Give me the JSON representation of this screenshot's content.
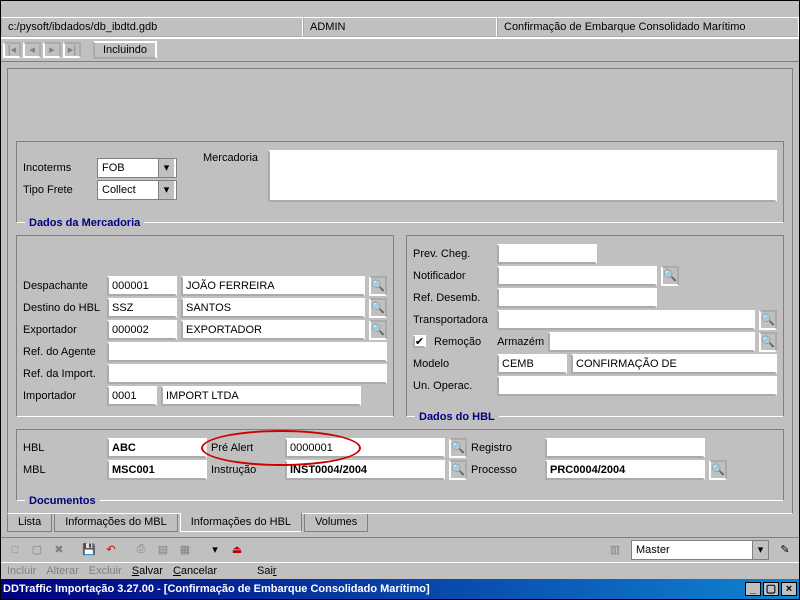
{
  "title": "DDTraffic Importação 3.27.00 - [Confirmação de Embarque Consolidado Marítimo]",
  "menu": {
    "incluir": "Incluir",
    "alterar": "Alterar",
    "excluir": "Excluir",
    "salvar": "Salvar",
    "cancelar": "Cancelar",
    "sair": "Sair"
  },
  "master": {
    "label": "Master"
  },
  "tabs": {
    "lista": "Lista",
    "imbl": "Informações do MBL",
    "ihbl": "Informações do HBL",
    "vol": "Volumes"
  },
  "doc": {
    "legend": "Documentos",
    "mbl_l": "MBL",
    "mbl": "MSC001",
    "instr_l": "Instrução",
    "instr": "INST0004/2004",
    "proc_l": "Processo",
    "proc": "PRC0004/2004",
    "hbl_l": "HBL",
    "hbl": "ABC",
    "pre_l": "Pré Alert",
    "pre": "0000001",
    "reg_l": "Registro",
    "reg": ""
  },
  "hbldata": {
    "legend": "Dados do HBL",
    "un_l": "Un. Operac.",
    "un": "",
    "mod_l": "Modelo",
    "mod_c": "CEMB",
    "mod_n": "CONFIRMAÇÃO DE",
    "rem_l": "Remoção",
    "arm_l": "Armazém",
    "arm": "",
    "trans_l": "Transportadora",
    "trans": "",
    "ref_l": "Ref. Desemb.",
    "ref": "",
    "not_l": "Notificador",
    "not": "",
    "prev_l": "Prev. Cheg.",
    "prev": ""
  },
  "left": {
    "imp_l": "Importador",
    "imp_c": "0001",
    "imp_n": "IMPORT LTDA",
    "rimp_l": "Ref. da Import.",
    "rimp": "",
    "rage_l": "Ref. do Agente",
    "rage": "",
    "exp_l": "Exportador",
    "exp_c": "000002",
    "exp_n": "EXPORTADOR",
    "dest_l": "Destino do HBL",
    "dest_c": "SSZ",
    "dest_n": "SANTOS",
    "desp_l": "Despachante",
    "desp_c": "000001",
    "desp_n": "JOÃO FERREIRA"
  },
  "merc": {
    "legend": "Dados da Mercadoria",
    "frete_l": "Tipo Frete",
    "frete": "Collect",
    "merc_l": "Mercadoria",
    "inco_l": "Incoterms",
    "inco": "FOB"
  },
  "nav": {
    "state": "Incluindo"
  },
  "status": {
    "path": "c:/pysoft/ibdados/db_ibdtd.gdb",
    "user": "ADMIN",
    "ctx": "Confirmação de Embarque Consolidado Marítimo"
  }
}
